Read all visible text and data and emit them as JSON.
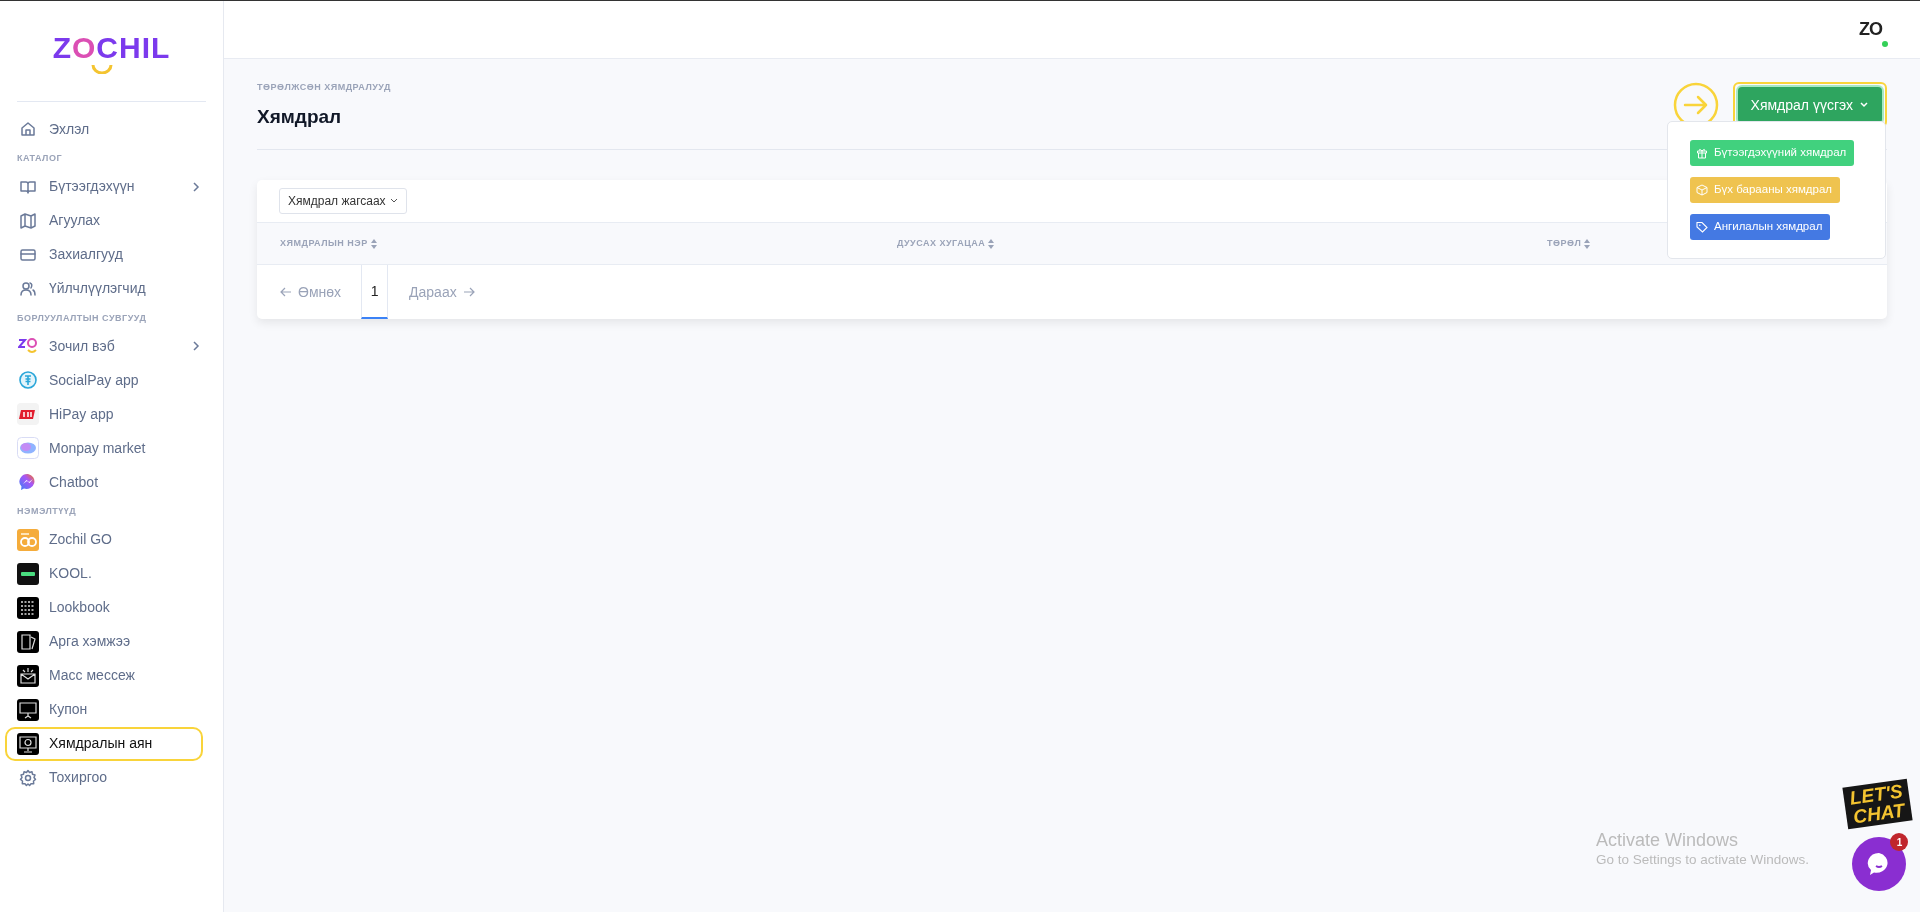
{
  "sidebar": {
    "logo": [
      {
        "text": "Z",
        "color": "#7c3aed"
      },
      {
        "text": "O",
        "color": "#db4fb4"
      },
      {
        "text": "CHIL",
        "color": "#7c3aed"
      }
    ],
    "items": [
      {
        "kind": "link",
        "label": "Эхлэл",
        "submenu": false,
        "selected": false,
        "highlighted": false
      },
      {
        "kind": "heading",
        "label": "КАТАЛОГ"
      },
      {
        "kind": "link",
        "label": "Бүтээгдэхүүн",
        "submenu": true,
        "selected": false,
        "highlighted": false
      },
      {
        "kind": "link",
        "label": "Агуулах",
        "submenu": false,
        "selected": false,
        "highlighted": false
      },
      {
        "kind": "link",
        "label": "Захиалгууд",
        "submenu": false,
        "selected": false,
        "highlighted": false
      },
      {
        "kind": "link",
        "label": "Үйлчлүүлэгчид",
        "submenu": false,
        "selected": false,
        "highlighted": false
      },
      {
        "kind": "heading",
        "label": "БОРЛУУЛАЛТЫН СУВГУУД"
      },
      {
        "kind": "link",
        "label": "Зочил вэб",
        "submenu": true,
        "selected": false,
        "highlighted": false
      },
      {
        "kind": "link",
        "label": "SocialPay app",
        "submenu": false,
        "selected": false,
        "highlighted": false
      },
      {
        "kind": "link",
        "label": "HiPay app",
        "submenu": false,
        "selected": false,
        "highlighted": false
      },
      {
        "kind": "link",
        "label": "Monpay market",
        "submenu": false,
        "selected": false,
        "highlighted": false
      },
      {
        "kind": "link",
        "label": "Chatbot",
        "submenu": false,
        "selected": false,
        "highlighted": false
      },
      {
        "kind": "heading",
        "label": "НЭМЭЛТҮҮД"
      },
      {
        "kind": "link",
        "label": "Zochil GO",
        "submenu": false,
        "selected": false,
        "highlighted": false
      },
      {
        "kind": "link",
        "label": "KOOL.",
        "submenu": false,
        "selected": false,
        "highlighted": false
      },
      {
        "kind": "link",
        "label": "Lookbook",
        "submenu": false,
        "selected": false,
        "highlighted": false
      },
      {
        "kind": "link",
        "label": "Арга хэмжээ",
        "submenu": false,
        "selected": false,
        "highlighted": false
      },
      {
        "kind": "link",
        "label": "Масс мессеж",
        "submenu": false,
        "selected": false,
        "highlighted": false
      },
      {
        "kind": "link",
        "label": "Купон",
        "submenu": false,
        "selected": false,
        "highlighted": false
      },
      {
        "kind": "link",
        "label": "Хямдралын аян",
        "submenu": false,
        "selected": true,
        "highlighted": true
      },
      {
        "kind": "link",
        "label": "Тохиргоо",
        "submenu": false,
        "selected": false,
        "highlighted": false
      }
    ]
  },
  "top_bar": {
    "account_logo": "ZO",
    "online": true
  },
  "page": {
    "breadcrumb": "ТӨРӨЛЖСӨН ХЯМДРАЛУУД",
    "title": "Хямдрал",
    "create_button": {
      "label": "Хямдрал үүсгэх",
      "open": true,
      "highlighted": true
    },
    "create_menu": [
      {
        "label": "Бүтээгдэхүүний хямдрал",
        "color": "#41d17e"
      },
      {
        "label": "Бүх барааны хямдрал",
        "color": "#efc34f"
      },
      {
        "label": "Ангилалын хямдрал",
        "color": "#4479e3"
      }
    ],
    "table": {
      "filter": "Хямдрал жагсаах",
      "columns": [
        "ХЯМДРАЛЫН НЭР",
        "ДУУСАХ ХУГАЦАА",
        "ТӨРӨЛ"
      ],
      "pagination": {
        "previous": "Өмнөх",
        "pages": [
          {
            "label": "1",
            "selected": true
          }
        ],
        "next": "Дараах"
      }
    }
  },
  "chat_widget": {
    "sticker": [
      "LET'S",
      "CHAT"
    ],
    "unread": "1"
  },
  "os_watermark": {
    "title": "Activate Windows",
    "subtitle": "Go to Settings to activate Windows."
  }
}
